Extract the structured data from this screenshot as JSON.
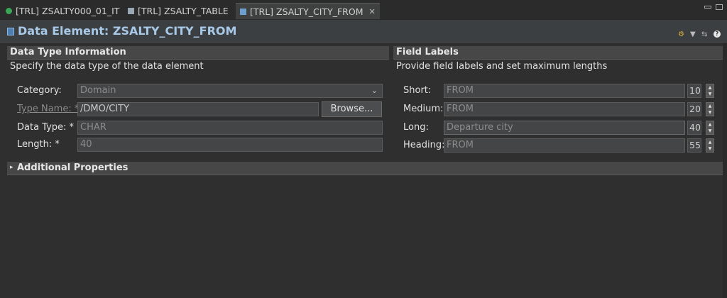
{
  "tabs": [
    {
      "label": "[TRL] ZSALTY000_01_IT",
      "active": false,
      "icon": "green-circle-icon"
    },
    {
      "label": "[TRL] ZSALTY_TABLE",
      "active": false,
      "icon": "table-icon"
    },
    {
      "label": "[TRL] ZSALTY_CITY_FROM",
      "active": true,
      "icon": "data-element-icon"
    }
  ],
  "editor": {
    "title": "Data Element: ZSALTY_CITY_FROM"
  },
  "data_type": {
    "title": "Data Type Information",
    "description": "Specify the data type of the data element",
    "category_label": "Category:",
    "category_value": "Domain",
    "type_name_label": "Type Name: *",
    "type_name_value": "/DMO/CITY",
    "browse_label": "Browse...",
    "data_type_label": "Data Type: *",
    "data_type_value": "CHAR",
    "length_label": "Length: *",
    "length_value": "40"
  },
  "field_labels": {
    "title": "Field Labels",
    "description": "Provide field labels and set maximum lengths",
    "rows": [
      {
        "label": "Short:",
        "value": "FROM",
        "max": "10"
      },
      {
        "label": "Medium:",
        "value": "FROM",
        "max": "20"
      },
      {
        "label": "Long:",
        "value": "Departure city",
        "max": "40"
      },
      {
        "label": "Heading:",
        "value": "FROM",
        "max": "55"
      }
    ]
  },
  "additional": {
    "title": "Additional Properties"
  }
}
